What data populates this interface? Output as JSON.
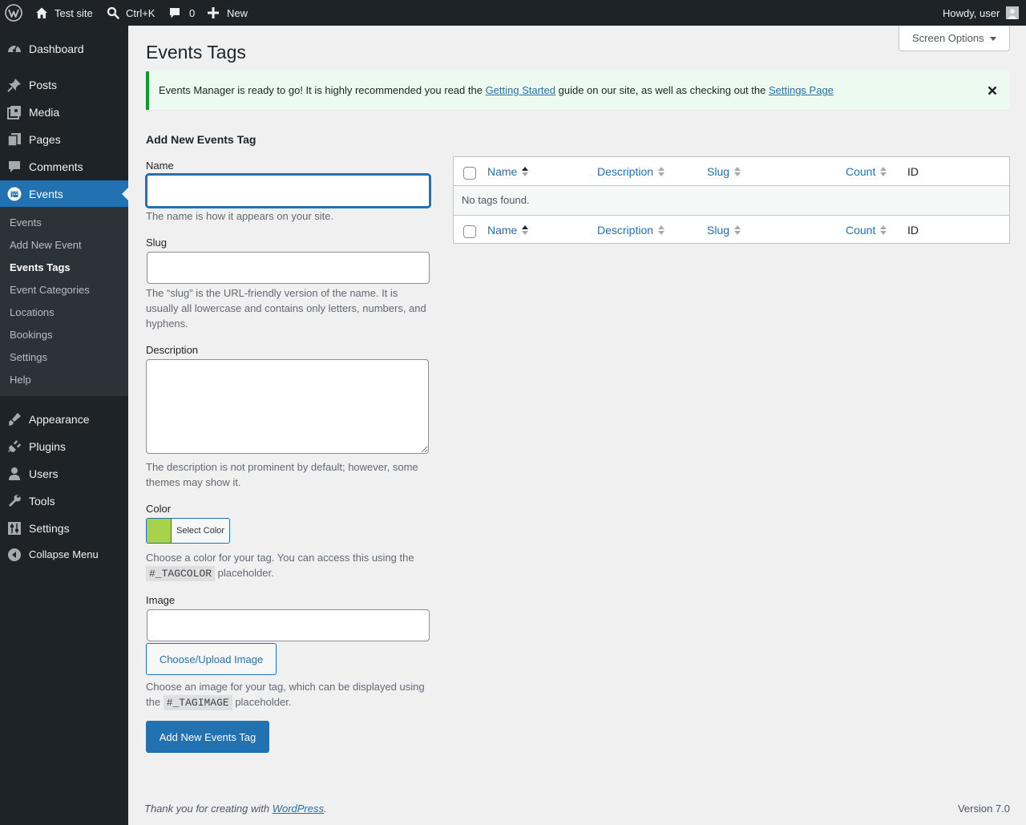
{
  "adminbar": {
    "site_name": "Test site",
    "search_shortcut": "Ctrl+K",
    "comments_count": "0",
    "new_label": "New",
    "greeting": "Howdy, user"
  },
  "sidebar": {
    "items": [
      {
        "label": "Dashboard",
        "icon": "dashboard-icon"
      },
      {
        "label": "Posts",
        "icon": "pin-icon"
      },
      {
        "label": "Media",
        "icon": "media-icon"
      },
      {
        "label": "Pages",
        "icon": "pages-icon"
      },
      {
        "label": "Comments",
        "icon": "comment-icon"
      },
      {
        "label": "Events",
        "icon": "calendar-icon",
        "current": true
      },
      {
        "label": "Appearance",
        "icon": "brush-icon"
      },
      {
        "label": "Plugins",
        "icon": "plug-icon"
      },
      {
        "label": "Users",
        "icon": "user-icon"
      },
      {
        "label": "Tools",
        "icon": "wrench-icon"
      },
      {
        "label": "Settings",
        "icon": "settings-icon"
      },
      {
        "label": "Collapse Menu",
        "icon": "collapse-icon"
      }
    ],
    "submenu": [
      "Events",
      "Add New Event",
      "Events Tags",
      "Event Categories",
      "Locations",
      "Bookings",
      "Settings",
      "Help"
    ],
    "submenu_current": "Events Tags"
  },
  "main": {
    "screen_options": "Screen Options",
    "title": "Events Tags",
    "notice": {
      "text_before": "Events Manager is ready to go! It is highly recommended you read the ",
      "link1": "Getting Started",
      "text_middle": " guide on our site, as well as checking out the ",
      "link2": "Settings Page"
    },
    "form": {
      "heading": "Add New Events Tag",
      "name_label": "Name",
      "name_value": "",
      "name_help": "The name is how it appears on your site.",
      "slug_label": "Slug",
      "slug_value": "",
      "slug_help": "The “slug” is the URL-friendly version of the name. It is usually all lowercase and contains only letters, numbers, and hyphens.",
      "description_label": "Description",
      "description_value": "",
      "description_help": "The description is not prominent by default; however, some themes may show it.",
      "color_label": "Color",
      "color_button": "Select Color",
      "color_value": "#a6d34a",
      "color_help_before": "Choose a color for your tag. You can access this using the ",
      "color_placeholder_code": "#_TAGCOLOR",
      "color_help_after": " placeholder.",
      "image_label": "Image",
      "image_value": "",
      "image_button": "Choose/Upload Image",
      "image_help_before": "Choose an image for your tag, which can be displayed using the ",
      "image_placeholder_code": "#_TAGIMAGE",
      "image_help_after": " placeholder.",
      "submit": "Add New Events Tag"
    },
    "table": {
      "columns": [
        "Name",
        "Description",
        "Slug",
        "Count",
        "ID"
      ],
      "empty": "No tags found."
    }
  },
  "footer": {
    "thanks_before": "Thank you for creating with ",
    "thanks_link": "WordPress",
    "thanks_after": ".",
    "version": "Version 7.0"
  },
  "colors": {
    "accent": "#2271b1",
    "adminbar": "#1d2327",
    "notice_border": "#00a32a"
  }
}
